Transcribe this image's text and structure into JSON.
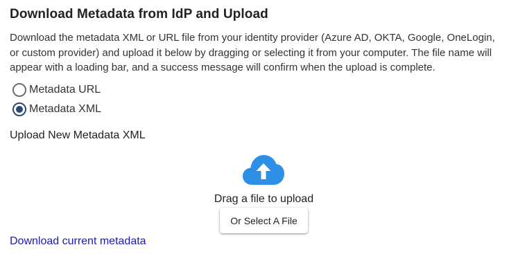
{
  "section": {
    "title": "Download Metadata from IdP and Upload",
    "description": "Download the metadata XML or URL file from your identity provider (Azure AD, OKTA, Google, OneLogin, or custom provider) and upload it below by dragging or selecting it from your computer. The file name will appear with a loading bar, and a success message will confirm when the upload is complete."
  },
  "options": [
    {
      "label": "Metadata URL",
      "selected": false
    },
    {
      "label": "Metadata XML",
      "selected": true
    }
  ],
  "upload": {
    "heading": "Upload New Metadata XML",
    "icon": "cloud-upload-icon",
    "drag_text": "Drag a file to upload",
    "select_button": "Or Select A File"
  },
  "links": {
    "download_current": "Download current metadata"
  },
  "colors": {
    "accent": "#2b4a72",
    "cloud": "#2e8fe6",
    "link": "#1a1ab8"
  }
}
